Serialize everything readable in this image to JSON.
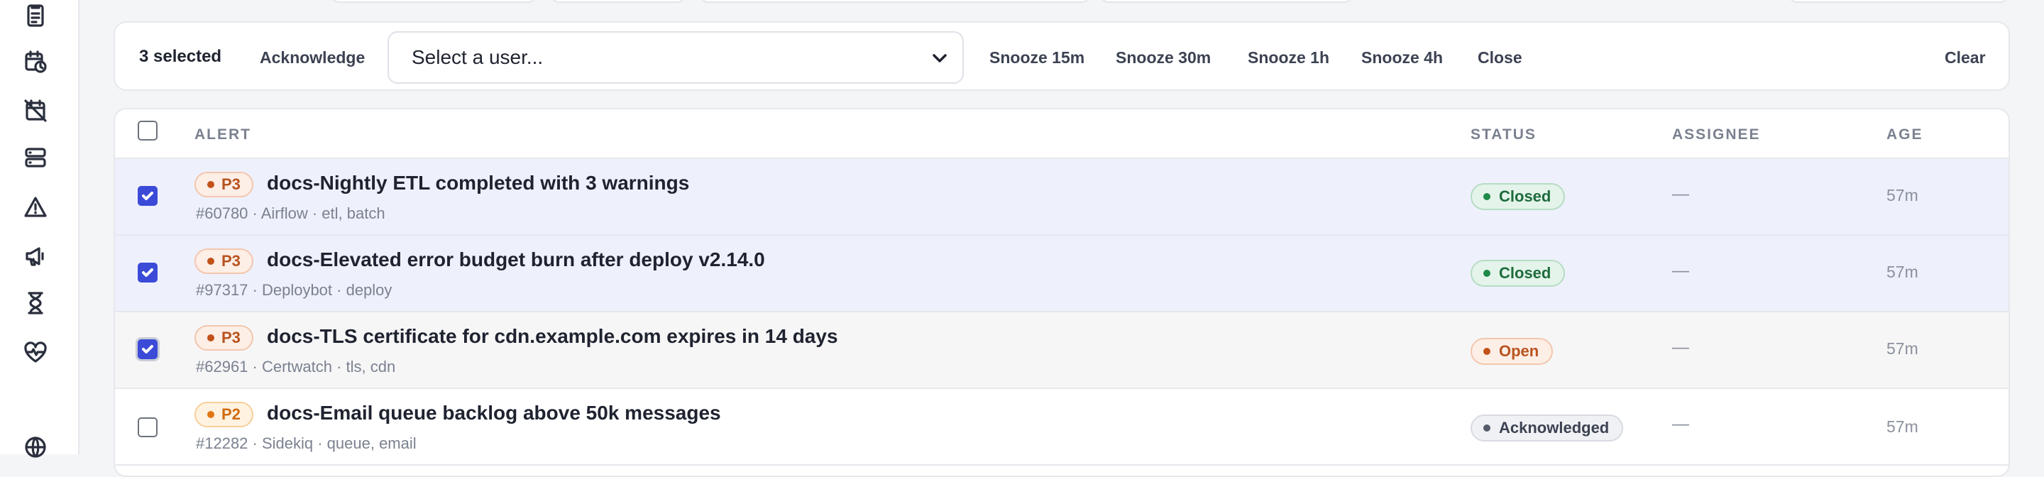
{
  "bulk": {
    "count_label": "3 selected",
    "acknowledge": "Acknowledge",
    "select_user": "Select a user...",
    "snooze_15": "Snooze 15m",
    "snooze_30": "Snooze 30m",
    "snooze_1h": "Snooze 1h",
    "snooze_4h": "Snooze 4h",
    "close": "Close",
    "clear": "Clear"
  },
  "table": {
    "headers": {
      "alert": "ALERT",
      "status": "STATUS",
      "assignee": "ASSIGNEE",
      "age": "AGE"
    },
    "rows": [
      {
        "priority": "P3",
        "title": "docs-Nightly ETL completed with 3 warnings",
        "meta": "#60780 · Airflow · etl, batch",
        "status": "Closed",
        "assignee": "—",
        "age": "57m",
        "selected": true
      },
      {
        "priority": "P3",
        "title": "docs-Elevated error budget burn after deploy v2.14.0",
        "meta": "#97317 · Deploybot · deploy",
        "status": "Closed",
        "assignee": "—",
        "age": "57m",
        "selected": true
      },
      {
        "priority": "P3",
        "title": "docs-TLS certificate for cdn.example.com expires in 14 days",
        "meta": "#62961 · Certwatch · tls, cdn",
        "status": "Open",
        "assignee": "—",
        "age": "57m",
        "selected": true
      },
      {
        "priority": "P2",
        "title": "docs-Email queue backlog above 50k messages",
        "meta": "#12282 · Sidekiq · queue, email",
        "status": "Acknowledged",
        "assignee": "—",
        "age": "57m",
        "selected": false
      }
    ]
  },
  "sidebar": {
    "icons": [
      "clipboard-icon",
      "calendar-clock-icon",
      "calendar-off-icon",
      "server-icon",
      "warning-icon",
      "megaphone-icon",
      "hourglass-icon",
      "heart-pulse-icon",
      "globe-icon"
    ]
  },
  "colors": {
    "accent": "#3b4bd8",
    "closed": "#1e8a4a",
    "open": "#c2521a",
    "selected_row": "#eef1fc"
  }
}
